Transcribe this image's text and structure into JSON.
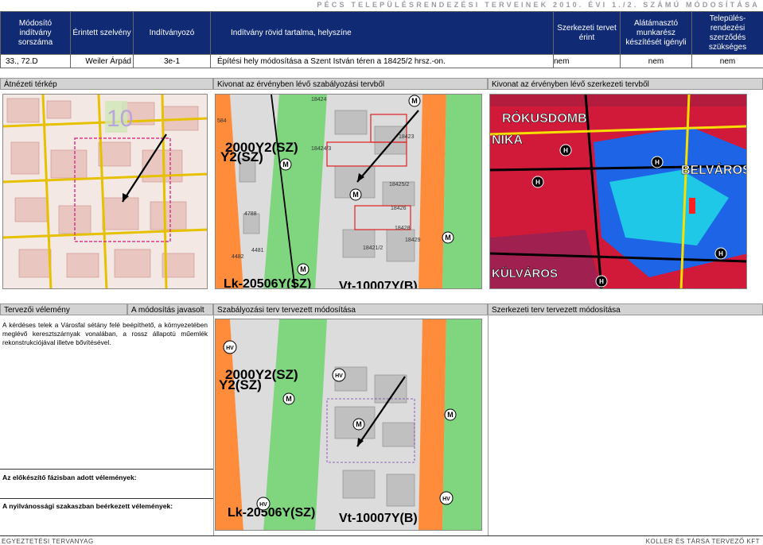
{
  "header": {
    "title": "PÉCS TELEPÜLÉSRENDEZÉSI TERVEINEK 2010. ÉVI 1./2. SZÁMÚ MÓDOSÍTÁSA"
  },
  "table": {
    "columns": [
      "Módosító indítvány sorszáma",
      "Érintett szelvény",
      "Indítványozó",
      "Indítvány rövid tartalma, helyszíne",
      "Szerkezeti tervet érint",
      "Alátámasztó munkarész készítését igényli",
      "Település-rendezési szerződés szükséges"
    ],
    "row": {
      "number": "33., 72.",
      "sheet": "D",
      "proposer": "Weiler Árpád",
      "zone": "3e-1",
      "content": "Építési hely módosítása a Szent István téren a 18425/2 hrsz.-on.",
      "structural": "nem",
      "supporting": "nem",
      "contract": "nem"
    }
  },
  "panels": {
    "overview_title": "Átnézeti térkép",
    "reg_current_title": "Kivonat az érvényben lévő szabályozási tervből",
    "struct_current_title": "Kivonat az érvényben lévő szerkezeti tervből",
    "designer_title": "Tervezői vélemény",
    "recommended": "A módosítás javasolt",
    "reg_planned_title": "Szabályozási terv tervezett módosítása",
    "struct_planned_title": "Szerkezeti terv tervezett módosítása"
  },
  "opinion": {
    "text": "A kérdéses telek a Városfal sétány felé beépíthető, a környezetében meglévő keresztszárnyak vonalában, a rossz állapotú műemlék rekonstrukciójával illetve bővítésével."
  },
  "labels": {
    "preparatory": "Az előkészítő fázisban adott vélemények:",
    "publicity": "A nyilvánossági szakaszban beérkezett vélemények:"
  },
  "maps": {
    "overview": {
      "big_number": "10"
    },
    "reg_current": {
      "zone_top": "2000Y2(SZ)",
      "zone_top_b": "Y2(SZ)",
      "zone_bottom_a": "Lk-20506Y(SZ)",
      "zone_bottom_b": "Vt-10007Y(B)",
      "m_marker": "M",
      "parcels": [
        "18424",
        "18423",
        "18425/2",
        "18426",
        "18428",
        "18429",
        "18421/2",
        "4788",
        "4481",
        "4482",
        "584",
        "18424/3"
      ]
    },
    "struct_current": {
      "label_a": "RÓKUSDOMB",
      "label_b": "NIKA",
      "label_c": "BELVÁROS",
      "label_d": "KÜLVÁROS",
      "hv_marker": "H"
    },
    "reg_planned": {
      "zone_top": "2000Y2(SZ)",
      "zone_top_b": "Y2(SZ)",
      "zone_bottom_a": "Lk-20506Y(SZ)",
      "zone_bottom_b": "Vt-10007Y(B)",
      "hv_marker": "HV",
      "m_marker": "M"
    }
  },
  "footer": {
    "left": "EGYEZTETÉSI TERVANYAG",
    "right": "KOLLER ÉS TÁRSA TERVEZŐ KFT"
  }
}
